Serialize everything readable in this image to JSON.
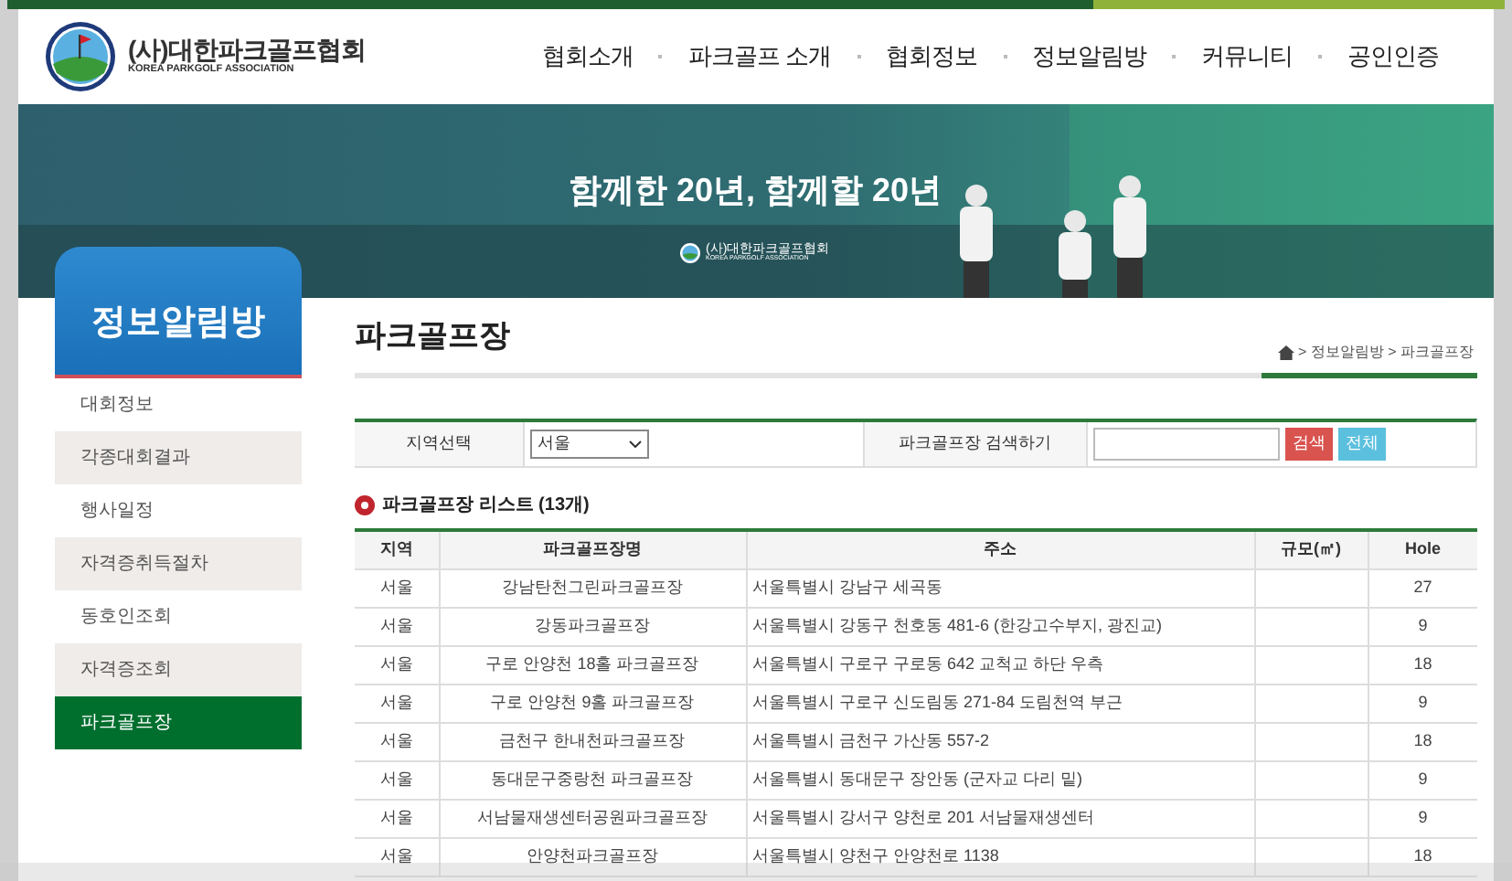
{
  "header": {
    "logo_title": "(사)대한파크골프협회",
    "logo_subtitle": "KOREA PARKGOLF ASSOCIATION",
    "nav": [
      "협회소개",
      "파크골프 소개",
      "협회정보",
      "정보알림방",
      "커뮤니티",
      "공인인증"
    ]
  },
  "banner": {
    "slogan": "함께한 20년, 함께할 20년",
    "logo_title": "(사)대한파크골프협회",
    "logo_subtitle": "KOREA PARKGOLF ASSOCIATION"
  },
  "sidebar": {
    "title": "정보알림방",
    "items": [
      {
        "label": "대회정보",
        "selected": false
      },
      {
        "label": "각종대회결과",
        "selected": false
      },
      {
        "label": "행사일정",
        "selected": false
      },
      {
        "label": "자격증취득절차",
        "selected": false
      },
      {
        "label": "동호인조회",
        "selected": false
      },
      {
        "label": "자격증조회",
        "selected": false
      },
      {
        "label": "파크골프장",
        "selected": true
      }
    ]
  },
  "page": {
    "title": "파크골프장",
    "breadcrumb": "> 정보알림방 > 파크골프장"
  },
  "filter": {
    "region_label": "지역선택",
    "region_value": "서울",
    "search_label": "파크골프장 검색하기",
    "search_button": "검색",
    "all_button": "전체"
  },
  "list": {
    "title": "파크골프장 리스트 (13개)",
    "columns": [
      "지역",
      "파크골프장명",
      "주소",
      "규모(㎡)",
      "Hole"
    ],
    "rows": [
      {
        "region": "서울",
        "name": "강남탄천그린파크골프장",
        "address": "서울특별시 강남구 세곡동",
        "holes": "27"
      },
      {
        "region": "서울",
        "name": "강동파크골프장",
        "address": "서울특별시 강동구 천호동 481-6 (한강고수부지, 광진교)",
        "holes": "9"
      },
      {
        "region": "서울",
        "name": "구로 안양천 18홀 파크골프장",
        "address": "서울특별시 구로구 구로동 642 교척교 하단 우측",
        "holes": "18"
      },
      {
        "region": "서울",
        "name": "구로 안양천 9홀 파크골프장",
        "address": "서울특별시 구로구 신도림동 271-84 도림천역 부근",
        "holes": "9"
      },
      {
        "region": "서울",
        "name": "금천구 한내천파크골프장",
        "address": "서울특별시 금천구 가산동 557-2",
        "holes": "18"
      },
      {
        "region": "서울",
        "name": "동대문구중랑천 파크골프장",
        "address": "서울특별시 동대문구 장안동 (군자교 다리 밑)",
        "holes": "9"
      },
      {
        "region": "서울",
        "name": "서남물재생센터공원파크골프장",
        "address": "서울특별시 강서구 양천로 201 서남물재생센터",
        "holes": "9"
      },
      {
        "region": "서울",
        "name": "안양천파크골프장",
        "address": "서울특별시 양천구 안양천로 1138",
        "holes": "18"
      }
    ]
  }
}
